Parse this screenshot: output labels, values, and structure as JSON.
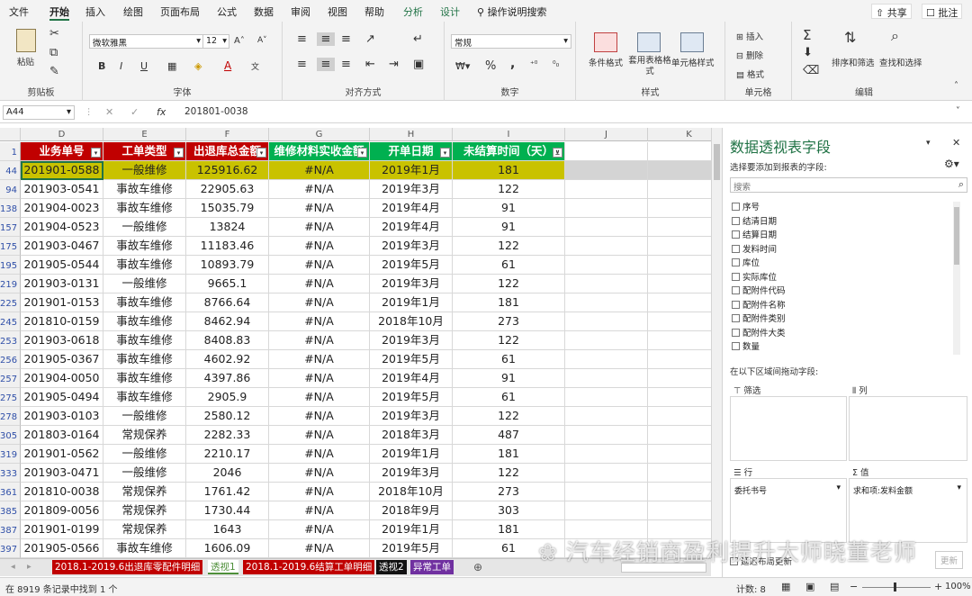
{
  "menu": {
    "tabs": [
      "文件",
      "开始",
      "插入",
      "绘图",
      "页面布局",
      "公式",
      "数据",
      "审阅",
      "视图",
      "帮助",
      "分析",
      "设计"
    ],
    "search_label": "操作说明搜索",
    "share": "共享",
    "comment": "批注"
  },
  "ribbon": {
    "clipboard": {
      "paste": "粘贴",
      "label": "剪贴板"
    },
    "font": {
      "name": "微软雅黑",
      "size": "12",
      "label": "字体",
      "bold": "B",
      "italic": "I",
      "underline": "U",
      "color_letter": "A"
    },
    "align": {
      "label": "对齐方式"
    },
    "number": {
      "format": "常规",
      "label": "数字",
      "percent": "%",
      "comma": ","
    },
    "styles": {
      "conditional": "条件格式",
      "table_fmt": "套用表格格式",
      "cell_style": "单元格样式",
      "label": "样式"
    },
    "cells": {
      "insert": "插入",
      "delete": "删除",
      "format": "格式",
      "label": "单元格"
    },
    "edit": {
      "sort_filter": "排序和筛选",
      "find_select": "查找和选择",
      "label": "编辑"
    }
  },
  "formula_bar": {
    "name_box": "A44",
    "fx": "fx",
    "value": "201801-0038"
  },
  "columns": [
    "D",
    "E",
    "F",
    "G",
    "H",
    "I",
    "J",
    "K"
  ],
  "header_row_num": "1",
  "headers": [
    "业务单号",
    "工单类型",
    "出退库总金额",
    "维修材料实收金额",
    "开单日期",
    "未结算时间（天）"
  ],
  "rows": [
    {
      "n": "44",
      "d": [
        "201901-0588",
        "一般维修",
        "125916.62",
        "#N/A",
        "2019年1月",
        "181"
      ]
    },
    {
      "n": "94",
      "d": [
        "201903-0541",
        "事故车维修",
        "22905.63",
        "#N/A",
        "2019年3月",
        "122"
      ]
    },
    {
      "n": "138",
      "d": [
        "201904-0023",
        "事故车维修",
        "15035.79",
        "#N/A",
        "2019年4月",
        "91"
      ]
    },
    {
      "n": "157",
      "d": [
        "201904-0523",
        "一般维修",
        "13824",
        "#N/A",
        "2019年4月",
        "91"
      ]
    },
    {
      "n": "175",
      "d": [
        "201903-0467",
        "事故车维修",
        "11183.46",
        "#N/A",
        "2019年3月",
        "122"
      ]
    },
    {
      "n": "195",
      "d": [
        "201905-0544",
        "事故车维修",
        "10893.79",
        "#N/A",
        "2019年5月",
        "61"
      ]
    },
    {
      "n": "219",
      "d": [
        "201903-0131",
        "一般维修",
        "9665.1",
        "#N/A",
        "2019年3月",
        "122"
      ]
    },
    {
      "n": "225",
      "d": [
        "201901-0153",
        "事故车维修",
        "8766.64",
        "#N/A",
        "2019年1月",
        "181"
      ]
    },
    {
      "n": "245",
      "d": [
        "201810-0159",
        "事故车维修",
        "8462.94",
        "#N/A",
        "2018年10月",
        "273"
      ]
    },
    {
      "n": "253",
      "d": [
        "201903-0618",
        "事故车维修",
        "8408.83",
        "#N/A",
        "2019年3月",
        "122"
      ]
    },
    {
      "n": "256",
      "d": [
        "201905-0367",
        "事故车维修",
        "4602.92",
        "#N/A",
        "2019年5月",
        "61"
      ]
    },
    {
      "n": "257",
      "d": [
        "201904-0050",
        "事故车维修",
        "4397.86",
        "#N/A",
        "2019年4月",
        "91"
      ]
    },
    {
      "n": "275",
      "d": [
        "201905-0494",
        "事故车维修",
        "2905.9",
        "#N/A",
        "2019年5月",
        "61"
      ]
    },
    {
      "n": "278",
      "d": [
        "201903-0103",
        "一般维修",
        "2580.12",
        "#N/A",
        "2019年3月",
        "122"
      ]
    },
    {
      "n": "305",
      "d": [
        "201803-0164",
        "常规保养",
        "2282.33",
        "#N/A",
        "2018年3月",
        "487"
      ]
    },
    {
      "n": "319",
      "d": [
        "201901-0562",
        "一般维修",
        "2210.17",
        "#N/A",
        "2019年1月",
        "181"
      ]
    },
    {
      "n": "333",
      "d": [
        "201903-0471",
        "一般维修",
        "2046",
        "#N/A",
        "2019年3月",
        "122"
      ]
    },
    {
      "n": "361",
      "d": [
        "201810-0038",
        "常规保养",
        "1761.42",
        "#N/A",
        "2018年10月",
        "273"
      ]
    },
    {
      "n": "385",
      "d": [
        "201809-0056",
        "常规保养",
        "1730.44",
        "#N/A",
        "2018年9月",
        "303"
      ]
    },
    {
      "n": "387",
      "d": [
        "201901-0199",
        "常规保养",
        "1643",
        "#N/A",
        "2019年1月",
        "181"
      ]
    },
    {
      "n": "397",
      "d": [
        "201905-0566",
        "事故车维修",
        "1606.09",
        "#N/A",
        "2019年5月",
        "61"
      ]
    }
  ],
  "sheet_tabs": [
    {
      "name": "2018.1-2019.6出退库零配件明细",
      "color": "#c00000"
    },
    {
      "name": "透视1",
      "color": "#4e8f3a"
    },
    {
      "name": "2018.1-2019.6结算工单明细",
      "color": "#c00000"
    },
    {
      "name": "透视2",
      "color": "#111111"
    },
    {
      "name": "异常工单",
      "color": "#7030a0"
    }
  ],
  "status": {
    "left": "在 8919 条记录中找到 1 个",
    "count": "计数: 8",
    "zoom": "100%"
  },
  "pivot": {
    "title": "数据透视表字段",
    "subtitle": "选择要添加到报表的字段:",
    "search": "搜索",
    "fields": [
      "序号",
      "结清日期",
      "结算日期",
      "发料时间",
      "库位",
      "实际库位",
      "配附件代码",
      "配附件名称",
      "配附件类别",
      "配附件大类",
      "数量"
    ],
    "drag_label": "在以下区域间拖动字段:",
    "filter": "筛选",
    "column": "列",
    "row": "行",
    "value": "值",
    "row_item": "委托书号",
    "value_item": "求和项:发料金额",
    "defer": "延迟布局更新",
    "update": "更新"
  },
  "watermark": "汽车经销商盈利提升大师晓董老师",
  "colors": {
    "header_red": "#c00000",
    "header_green": "#00b050",
    "selected_row": "#c9c200",
    "excel_green": "#217346"
  }
}
